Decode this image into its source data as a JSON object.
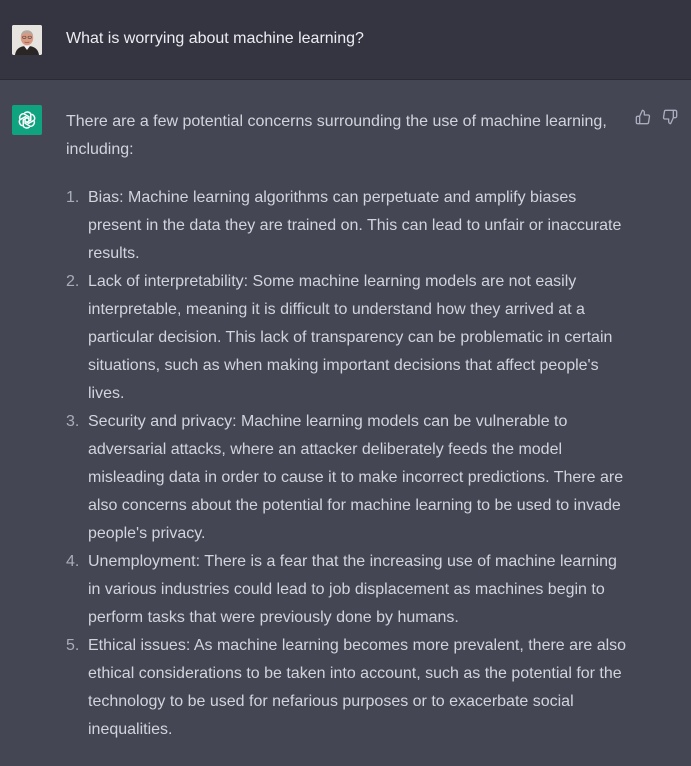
{
  "conversation": {
    "user": {
      "avatar_icon": "user-photo-avatar",
      "message": "What is worrying about machine learning?"
    },
    "assistant": {
      "avatar_icon": "openai-logo-icon",
      "avatar_color": "#10a37f",
      "intro": "There are a few potential concerns surrounding the use of machine learning, including:",
      "items": [
        {
          "number": "1.",
          "text": "Bias: Machine learning algorithms can perpetuate and amplify biases present in the data they are trained on. This can lead to unfair or inaccurate results."
        },
        {
          "number": "2.",
          "text": "Lack of interpretability: Some machine learning models are not easily interpretable, meaning it is difficult to understand how they arrived at a particular decision. This lack of transparency can be problematic in certain situations, such as when making important decisions that affect people's lives."
        },
        {
          "number": "3.",
          "text": "Security and privacy: Machine learning models can be vulnerable to adversarial attacks, where an attacker deliberately feeds the model misleading data in order to cause it to make incorrect predictions. There are also concerns about the potential for machine learning to be used to invade people's privacy."
        },
        {
          "number": "4.",
          "text": "Unemployment: There is a fear that the increasing use of machine learning in various industries could lead to job displacement as machines begin to perform tasks that were previously done by humans."
        },
        {
          "number": "5.",
          "text": "Ethical issues: As machine learning becomes more prevalent, there are also ethical considerations to be taken into account, such as the potential for the technology to be used for nefarious purposes or to exacerbate social inequalities."
        }
      ],
      "feedback_icons": [
        "thumbs-up-icon",
        "thumbs-down-icon"
      ]
    }
  },
  "colors": {
    "user_row_bg": "#343541",
    "assistant_row_bg": "#444654",
    "text": "#d1d5db"
  }
}
